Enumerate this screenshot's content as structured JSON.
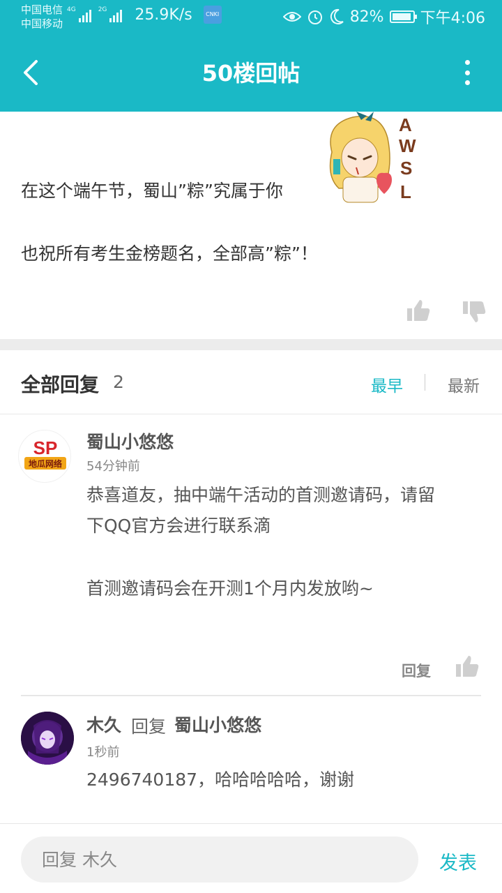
{
  "status_bar": {
    "carrier1": "中国电信",
    "carrier2": "中国移动",
    "net1": "4G",
    "net2": "2G",
    "speed": "25.9K/s",
    "app_badge": "CNKI",
    "battery": "82%",
    "time": "下午4:06"
  },
  "header": {
    "title": "50楼回帖"
  },
  "post": {
    "sticker_text": "AWSL",
    "line1": "在这个端午节，蜀山”粽”究属于你",
    "line2": "也祝所有考生金榜题名，全部高”粽”！"
  },
  "replies": {
    "title": "全部回复",
    "count": "2",
    "sort_earliest": "最早",
    "sort_latest": "最新",
    "items": [
      {
        "user": "蜀山小悠悠",
        "avatar_text": "SP",
        "avatar_subtext": "地瓜网络",
        "time": "54分钟前",
        "text_line1": "恭喜道友，抽中端午活动的首测邀请码，请留",
        "text_line2": "下QQ官方会进行联系滴",
        "text_line3": "首测邀请码会在开测1个月内发放哟~",
        "reply_label": "回复"
      },
      {
        "user": "木久",
        "reply_word": "回复",
        "reply_to": "蜀山小悠悠",
        "time": "1秒前",
        "text": "2496740187，哈哈哈哈哈，谢谢"
      }
    ]
  },
  "bottom_bar": {
    "placeholder": "回复 木久",
    "send_label": "发表"
  },
  "colors": {
    "accent": "#1ab9c6"
  }
}
